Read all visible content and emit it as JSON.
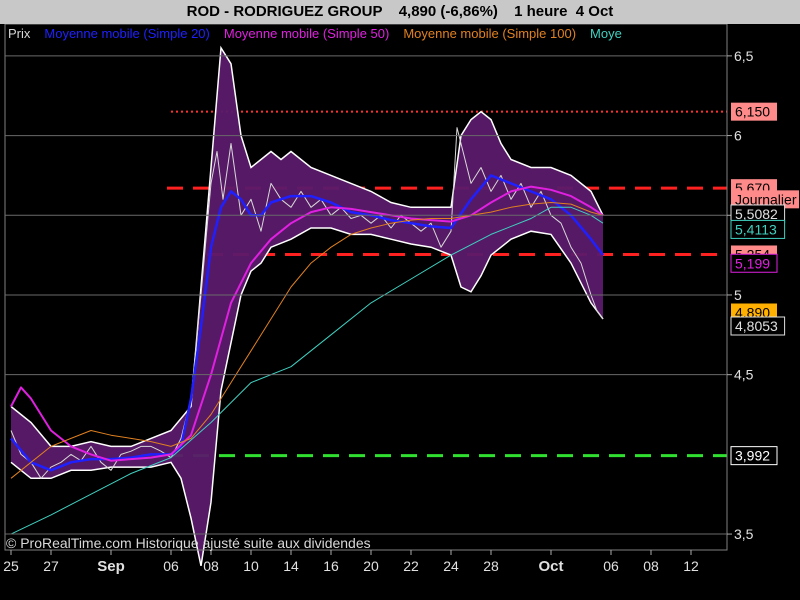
{
  "header": {
    "symbol_name": "ROD - RODRIGUEZ GROUP",
    "quote": "4,890 (-6,86%)",
    "timeframe": "1 heure  4 Oct"
  },
  "legend": [
    {
      "label": "Prix",
      "color": "#d8d8d8"
    },
    {
      "label": "Moyenne mobile (Simple 20)",
      "color": "#2020ff"
    },
    {
      "label": "Moyenne mobile (Simple 50)",
      "color": "#e020e0"
    },
    {
      "label": "Moyenne mobile (Simple 100)",
      "color": "#e08020"
    },
    {
      "label": "Moye",
      "color": "#40d0c0"
    }
  ],
  "footer_note": "© ProRealTime.com Historique ajusté suite aux dividendes",
  "right_labels": [
    {
      "text": "6,150",
      "value": 6.15,
      "bg": "#ff8a8a",
      "fg": "#000000"
    },
    {
      "text": "5,670",
      "value": 5.67,
      "bg": "#ff8a8a",
      "fg": "#000000"
    },
    {
      "text": "Journalier",
      "value": 5.6,
      "bg": "#ff8a8a",
      "fg": "#000000"
    },
    {
      "text": "5,5082",
      "value": 5.5082,
      "bg": "#000000",
      "fg": "#e0e0e0",
      "border": "#e0e0e0"
    },
    {
      "text": "5,4113",
      "value": 5.4113,
      "bg": "#000000",
      "fg": "#40d0c0",
      "border": "#40d0c0"
    },
    {
      "text": "5,254",
      "value": 5.254,
      "bg": "#ff8a8a",
      "fg": "#000000"
    },
    {
      "text": "5,199",
      "value": 5.199,
      "bg": "#000000",
      "fg": "#e020e0",
      "border": "#e020e0"
    },
    {
      "text": "4,890",
      "value": 4.89,
      "bg": "#ffb000",
      "fg": "#000000"
    },
    {
      "text": "4,8053",
      "value": 4.8053,
      "bg": "#000000",
      "fg": "#e0e0e0",
      "border": "#e0e0e0"
    },
    {
      "text": "3,992",
      "value": 3.992,
      "bg": "#000000",
      "fg": "#ffffff",
      "border": "#ffffff"
    }
  ],
  "chart_data": {
    "type": "line",
    "title": "ROD - RODRIGUEZ GROUP",
    "ylim": [
      3.4,
      6.7
    ],
    "y_ticks": [
      {
        "value": 6.5,
        "label": "6,5"
      },
      {
        "value": 6.0,
        "label": "6"
      },
      {
        "value": 5.5,
        "label": "5,5"
      },
      {
        "value": 5.0,
        "label": "5"
      },
      {
        "value": 4.5,
        "label": "4,5"
      },
      {
        "value": 3.5,
        "label": "3,5"
      }
    ],
    "x_ticks": [
      {
        "day": 0,
        "label": "25",
        "bold": false
      },
      {
        "day": 2,
        "label": "27",
        "bold": false
      },
      {
        "day": 5,
        "label": "Sep",
        "bold": true
      },
      {
        "day": 8,
        "label": "06",
        "bold": false
      },
      {
        "day": 10,
        "label": "08",
        "bold": false
      },
      {
        "day": 12,
        "label": "10",
        "bold": false
      },
      {
        "day": 14,
        "label": "14",
        "bold": false
      },
      {
        "day": 16,
        "label": "16",
        "bold": false
      },
      {
        "day": 18,
        "label": "20",
        "bold": false
      },
      {
        "day": 20,
        "label": "22",
        "bold": false
      },
      {
        "day": 22,
        "label": "24",
        "bold": false
      },
      {
        "day": 24,
        "label": "28",
        "bold": false
      },
      {
        "day": 27,
        "label": "Oct",
        "bold": true
      },
      {
        "day": 30,
        "label": "06",
        "bold": false
      },
      {
        "day": 32,
        "label": "08",
        "bold": false
      },
      {
        "day": 34,
        "label": "12",
        "bold": false
      }
    ],
    "x_range": [
      -0.3,
      35.8
    ],
    "horizontal_levels": [
      {
        "value": 6.15,
        "color": "#ff3030",
        "style": "dotted",
        "from_day": 8
      },
      {
        "value": 5.67,
        "color": "#ff2020",
        "style": "dashed",
        "from_day": 7.8
      },
      {
        "value": 5.254,
        "color": "#ff2020",
        "style": "dashed",
        "from_day": 9.8
      },
      {
        "value": 3.992,
        "color": "#30e030",
        "style": "dashed",
        "from_day": 6.5
      }
    ],
    "series": [
      {
        "name": "Prix",
        "color": "#d8d8d8",
        "points": [
          [
            0,
            4.15
          ],
          [
            0.5,
            4.0
          ],
          [
            1,
            3.95
          ],
          [
            1.5,
            3.85
          ],
          [
            2,
            3.92
          ],
          [
            2.5,
            3.95
          ],
          [
            3,
            4.0
          ],
          [
            3.5,
            3.96
          ],
          [
            4,
            4.05
          ],
          [
            4.5,
            3.95
          ],
          [
            5,
            3.9
          ],
          [
            5.5,
            4.0
          ],
          [
            6,
            4.02
          ],
          [
            6.5,
            4.05
          ],
          [
            7,
            4.05
          ],
          [
            7.5,
            4.02
          ],
          [
            8,
            3.98
          ],
          [
            8.5,
            4.1
          ],
          [
            9,
            4.35
          ],
          [
            9.5,
            5.0
          ],
          [
            10,
            5.7
          ],
          [
            10.3,
            5.9
          ],
          [
            10.6,
            5.6
          ],
          [
            11,
            5.95
          ],
          [
            11.5,
            5.5
          ],
          [
            12,
            5.6
          ],
          [
            12.5,
            5.4
          ],
          [
            13,
            5.7
          ],
          [
            13.5,
            5.6
          ],
          [
            14,
            5.55
          ],
          [
            14.5,
            5.65
          ],
          [
            15,
            5.55
          ],
          [
            15.5,
            5.6
          ],
          [
            16,
            5.5
          ],
          [
            16.5,
            5.55
          ],
          [
            17,
            5.48
          ],
          [
            17.5,
            5.5
          ],
          [
            18,
            5.45
          ],
          [
            18.5,
            5.5
          ],
          [
            19,
            5.42
          ],
          [
            19.5,
            5.5
          ],
          [
            20,
            5.45
          ],
          [
            20.5,
            5.4
          ],
          [
            21,
            5.45
          ],
          [
            21.5,
            5.3
          ],
          [
            22,
            5.4
          ],
          [
            22.3,
            6.05
          ],
          [
            22.6,
            5.9
          ],
          [
            23,
            5.7
          ],
          [
            23.5,
            5.8
          ],
          [
            24,
            5.65
          ],
          [
            24.5,
            5.75
          ],
          [
            25,
            5.6
          ],
          [
            25.5,
            5.7
          ],
          [
            26,
            5.55
          ],
          [
            26.5,
            5.65
          ],
          [
            27,
            5.5
          ],
          [
            27.5,
            5.45
          ],
          [
            28,
            5.3
          ],
          [
            28.5,
            5.2
          ],
          [
            29,
            5.0
          ],
          [
            29.3,
            4.9
          ],
          [
            29.6,
            4.85
          ]
        ]
      },
      {
        "name": "Moyenne mobile (Simple 20)",
        "color": "#2020ff",
        "points": [
          [
            0,
            4.1
          ],
          [
            1,
            3.95
          ],
          [
            2,
            3.9
          ],
          [
            3,
            3.95
          ],
          [
            4,
            3.97
          ],
          [
            5,
            3.97
          ],
          [
            6,
            3.98
          ],
          [
            7,
            4.0
          ],
          [
            8,
            4.0
          ],
          [
            8.5,
            4.05
          ],
          [
            9,
            4.35
          ],
          [
            9.5,
            4.8
          ],
          [
            10,
            5.3
          ],
          [
            10.5,
            5.55
          ],
          [
            11,
            5.65
          ],
          [
            11.5,
            5.6
          ],
          [
            12,
            5.5
          ],
          [
            12.5,
            5.5
          ],
          [
            13,
            5.58
          ],
          [
            14,
            5.62
          ],
          [
            15,
            5.62
          ],
          [
            16,
            5.58
          ],
          [
            17,
            5.52
          ],
          [
            18,
            5.5
          ],
          [
            19,
            5.47
          ],
          [
            20,
            5.45
          ],
          [
            21,
            5.43
          ],
          [
            22,
            5.42
          ],
          [
            23,
            5.6
          ],
          [
            24,
            5.75
          ],
          [
            25,
            5.7
          ],
          [
            26,
            5.65
          ],
          [
            27,
            5.6
          ],
          [
            28,
            5.5
          ],
          [
            29,
            5.35
          ],
          [
            29.6,
            5.25
          ]
        ]
      },
      {
        "name": "Moyenne mobile (Simple 50)",
        "color": "#e020e0",
        "points": [
          [
            0,
            4.3
          ],
          [
            0.5,
            4.42
          ],
          [
            1,
            4.35
          ],
          [
            2,
            4.15
          ],
          [
            3,
            4.05
          ],
          [
            4,
            4.0
          ],
          [
            5,
            3.96
          ],
          [
            6,
            3.97
          ],
          [
            7,
            3.98
          ],
          [
            8,
            4.0
          ],
          [
            9,
            4.12
          ],
          [
            10,
            4.5
          ],
          [
            11,
            4.95
          ],
          [
            12,
            5.2
          ],
          [
            13,
            5.35
          ],
          [
            14,
            5.45
          ],
          [
            15,
            5.52
          ],
          [
            16,
            5.55
          ],
          [
            17,
            5.54
          ],
          [
            18,
            5.52
          ],
          [
            19,
            5.5
          ],
          [
            20,
            5.48
          ],
          [
            21,
            5.47
          ],
          [
            22,
            5.46
          ],
          [
            23,
            5.5
          ],
          [
            24,
            5.58
          ],
          [
            25,
            5.65
          ],
          [
            26,
            5.68
          ],
          [
            27,
            5.66
          ],
          [
            28,
            5.62
          ],
          [
            29,
            5.55
          ],
          [
            29.6,
            5.5
          ]
        ]
      },
      {
        "name": "Moyenne mobile (Simple 100)",
        "color": "#e08020",
        "points": [
          [
            0,
            3.85
          ],
          [
            1,
            3.95
          ],
          [
            2,
            4.05
          ],
          [
            3,
            4.1
          ],
          [
            4,
            4.15
          ],
          [
            5,
            4.12
          ],
          [
            6,
            4.1
          ],
          [
            7,
            4.08
          ],
          [
            8,
            4.05
          ],
          [
            9,
            4.1
          ],
          [
            10,
            4.25
          ],
          [
            11,
            4.45
          ],
          [
            12,
            4.65
          ],
          [
            13,
            4.85
          ],
          [
            14,
            5.05
          ],
          [
            15,
            5.2
          ],
          [
            16,
            5.3
          ],
          [
            17,
            5.38
          ],
          [
            18,
            5.42
          ],
          [
            19,
            5.45
          ],
          [
            20,
            5.47
          ],
          [
            21,
            5.48
          ],
          [
            22,
            5.48
          ],
          [
            23,
            5.5
          ],
          [
            24,
            5.52
          ],
          [
            25,
            5.55
          ],
          [
            26,
            5.57
          ],
          [
            27,
            5.58
          ],
          [
            28,
            5.57
          ],
          [
            29,
            5.52
          ],
          [
            29.6,
            5.5
          ]
        ]
      },
      {
        "name": "Moye",
        "color": "#40d0c0",
        "points": [
          [
            0,
            3.5
          ],
          [
            2,
            3.62
          ],
          [
            4,
            3.75
          ],
          [
            6,
            3.88
          ],
          [
            8,
            3.98
          ],
          [
            10,
            4.2
          ],
          [
            12,
            4.45
          ],
          [
            14,
            4.55
          ],
          [
            16,
            4.75
          ],
          [
            18,
            4.95
          ],
          [
            20,
            5.1
          ],
          [
            22,
            5.25
          ],
          [
            24,
            5.38
          ],
          [
            26,
            5.48
          ],
          [
            27,
            5.55
          ],
          [
            28,
            5.55
          ],
          [
            29,
            5.5
          ],
          [
            29.6,
            5.45
          ]
        ]
      }
    ],
    "bollinger_bands": {
      "fill": "#5a1a6a",
      "stroke": "#ffffff",
      "upper": [
        [
          0,
          4.3
        ],
        [
          1,
          4.2
        ],
        [
          2,
          4.05
        ],
        [
          3,
          4.05
        ],
        [
          4,
          4.08
        ],
        [
          5,
          4.05
        ],
        [
          6,
          4.05
        ],
        [
          7,
          4.1
        ],
        [
          8,
          4.15
        ],
        [
          9,
          4.3
        ],
        [
          10,
          5.8
        ],
        [
          10.5,
          6.55
        ],
        [
          11,
          6.45
        ],
        [
          11.5,
          6.0
        ],
        [
          12,
          5.8
        ],
        [
          12.5,
          5.85
        ],
        [
          13,
          5.9
        ],
        [
          13.5,
          5.85
        ],
        [
          14,
          5.9
        ],
        [
          15,
          5.8
        ],
        [
          16,
          5.75
        ],
        [
          17,
          5.7
        ],
        [
          18,
          5.65
        ],
        [
          19,
          5.58
        ],
        [
          20,
          5.55
        ],
        [
          21,
          5.55
        ],
        [
          22,
          5.55
        ],
        [
          22.5,
          6.0
        ],
        [
          23,
          6.1
        ],
        [
          23.5,
          6.15
        ],
        [
          24,
          6.1
        ],
        [
          24.5,
          5.95
        ],
        [
          25,
          5.85
        ],
        [
          26,
          5.8
        ],
        [
          27,
          5.8
        ],
        [
          28,
          5.75
        ],
        [
          29,
          5.65
        ],
        [
          29.6,
          5.5
        ]
      ],
      "lower": [
        [
          0,
          3.95
        ],
        [
          1,
          3.85
        ],
        [
          2,
          3.85
        ],
        [
          3,
          3.9
        ],
        [
          4,
          3.9
        ],
        [
          5,
          3.92
        ],
        [
          6,
          3.92
        ],
        [
          7,
          3.92
        ],
        [
          8,
          3.95
        ],
        [
          8.5,
          3.85
        ],
        [
          9,
          3.6
        ],
        [
          9.5,
          3.3
        ],
        [
          10,
          3.7
        ],
        [
          10.5,
          4.4
        ],
        [
          11,
          4.7
        ],
        [
          11.5,
          5.0
        ],
        [
          12,
          5.15
        ],
        [
          12.5,
          5.2
        ],
        [
          13,
          5.3
        ],
        [
          14,
          5.35
        ],
        [
          15,
          5.42
        ],
        [
          16,
          5.42
        ],
        [
          17,
          5.38
        ],
        [
          18,
          5.38
        ],
        [
          19,
          5.35
        ],
        [
          20,
          5.32
        ],
        [
          21,
          5.3
        ],
        [
          22,
          5.25
        ],
        [
          22.5,
          5.05
        ],
        [
          23,
          5.02
        ],
        [
          23.5,
          5.12
        ],
        [
          24,
          5.25
        ],
        [
          25,
          5.35
        ],
        [
          26,
          5.4
        ],
        [
          27,
          5.38
        ],
        [
          28,
          5.2
        ],
        [
          29,
          4.95
        ],
        [
          29.6,
          4.85
        ]
      ]
    }
  }
}
